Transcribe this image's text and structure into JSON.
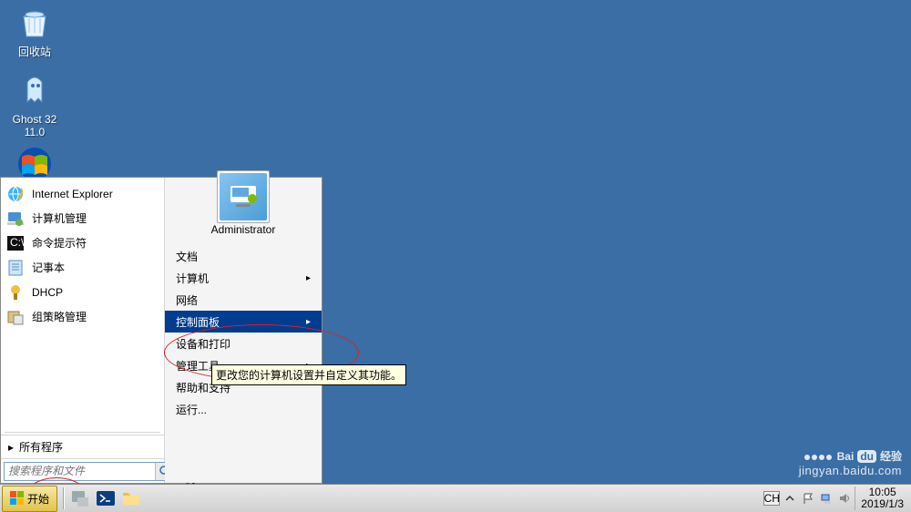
{
  "desktop": {
    "icons": [
      {
        "name": "回收站"
      },
      {
        "name": "Ghost 32",
        "line2": "11.0"
      },
      {
        "name": ""
      }
    ]
  },
  "start_menu": {
    "left_items": [
      {
        "label": "Internet Explorer"
      },
      {
        "label": "计算机管理"
      },
      {
        "label": "命令提示符"
      },
      {
        "label": "记事本"
      },
      {
        "label": "DHCP"
      },
      {
        "label": "组策略管理"
      }
    ],
    "all_programs": "所有程序",
    "search_placeholder": "搜索程序和文件",
    "shutdown_label": "关机",
    "user_name": "Administrator",
    "right_items": [
      {
        "label": "文档"
      },
      {
        "label": "计算机",
        "arrow": true
      },
      {
        "label": "网络"
      },
      {
        "label": "控制面板",
        "selected": true,
        "arrow": true
      },
      {
        "label": "设备和打印"
      },
      {
        "label": "管理工具",
        "arrow": true
      },
      {
        "label": "帮助和支持"
      },
      {
        "label": "运行..."
      }
    ]
  },
  "tooltip": "更改您的计算机设置并自定义其功能。",
  "taskbar": {
    "start": "开始",
    "lang": "CH",
    "time": "10:05",
    "date": "2019/1/3"
  },
  "watermark": {
    "bai": "Bai",
    "du": "du",
    "jy": "经验",
    "url": "jingyan.baidu.com"
  }
}
